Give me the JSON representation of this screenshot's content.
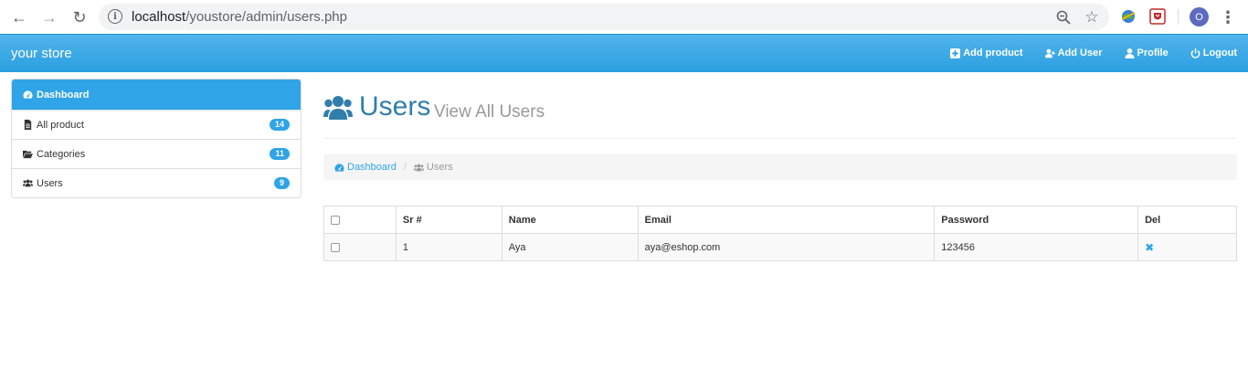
{
  "browser": {
    "url_host": "localhost",
    "url_path": "/youstore/admin/users.php",
    "avatar_letter": "O"
  },
  "navbar": {
    "brand": "your store",
    "links": [
      {
        "label": "Add product",
        "icon": "plus-square-icon"
      },
      {
        "label": "Add User",
        "icon": "user-plus-icon"
      },
      {
        "label": "Profile",
        "icon": "user-icon"
      },
      {
        "label": "Logout",
        "icon": "power-icon"
      }
    ]
  },
  "sidebar": {
    "items": [
      {
        "label": "Dashboard",
        "icon": "dashboard-icon",
        "badge": ""
      },
      {
        "label": "All product",
        "icon": "file-icon",
        "badge": "14"
      },
      {
        "label": "Categories",
        "icon": "folder-open-icon",
        "badge": "11"
      },
      {
        "label": "Users",
        "icon": "users-icon",
        "badge": "9"
      }
    ]
  },
  "header": {
    "title": "Users",
    "subtitle": "View All Users"
  },
  "breadcrumb": {
    "home": "Dashboard",
    "current": "Users"
  },
  "table": {
    "columns": [
      "",
      "Sr #",
      "Name",
      "Email",
      "Password",
      "Del"
    ],
    "rows": [
      {
        "sr": "1",
        "name": "Aya",
        "email": "aya@eshop.com",
        "password": "123456"
      }
    ]
  },
  "colors": {
    "accent": "#2fa4e7",
    "title": "#317eac"
  }
}
